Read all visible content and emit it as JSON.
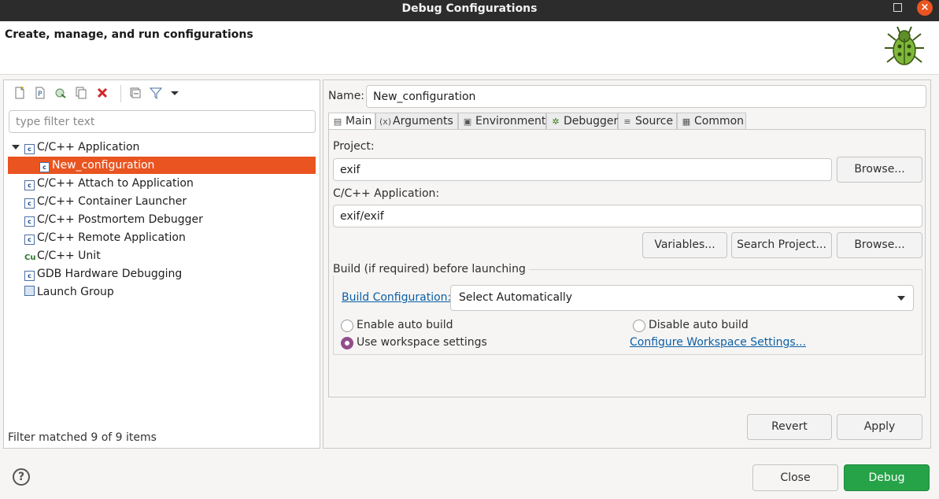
{
  "window": {
    "title": "Debug Configurations",
    "maximize_icon": "maximize-icon",
    "close_icon": "close-icon"
  },
  "header": {
    "subtitle": "Create, manage, and run configurations",
    "logo_icon": "debug-bug-icon"
  },
  "left": {
    "toolbar": [
      "new-configuration-icon",
      "new-prototype-icon",
      "export-icon",
      "duplicate-icon",
      "delete-icon",
      "collapse-all-icon",
      "filter-icon",
      "dropdown-arrow-icon"
    ],
    "filter_placeholder": "type filter text",
    "filter_value": "",
    "tree": [
      {
        "label": "C/C++ Application",
        "expanded": true
      },
      {
        "label": "New_configuration",
        "selected": true
      },
      {
        "label": "C/C++ Attach to Application"
      },
      {
        "label": "C/C++ Container Launcher"
      },
      {
        "label": "C/C++ Postmortem Debugger"
      },
      {
        "label": "C/C++ Remote Application"
      },
      {
        "label": "C/C++ Unit"
      },
      {
        "label": "GDB Hardware Debugging"
      },
      {
        "label": "Launch Group"
      }
    ],
    "status": "Filter matched 9 of 9 items"
  },
  "right": {
    "name_label": "Name:",
    "name_value": "New_configuration",
    "tabs": [
      {
        "label": "Main",
        "icon": "main-tab-icon",
        "active": true
      },
      {
        "label": "Arguments",
        "icon": "arguments-icon"
      },
      {
        "label": "Environment",
        "icon": "environment-icon"
      },
      {
        "label": "Debugger",
        "icon": "debugger-icon"
      },
      {
        "label": "Source",
        "icon": "source-icon"
      },
      {
        "label": "Common",
        "icon": "common-icon"
      }
    ],
    "main": {
      "project_label": "Project:",
      "project_value": "exif",
      "browse_label": "Browse...",
      "app_label": "C/C++ Application:",
      "app_value": "exif/exif",
      "variables_label": "Variables...",
      "search_project_label": "Search Project...",
      "browse2_label": "Browse...",
      "build_group_label": "Build (if required) before launching",
      "build_config_link": "Build Configuration:",
      "build_config_value": "Select Automatically",
      "enable_auto_build": "Enable auto build",
      "disable_auto_build": "Disable auto build",
      "use_workspace": "Use workspace settings",
      "configure_workspace_link": "Configure Workspace Settings...",
      "selected_radio": "use_workspace"
    },
    "revert_label": "Revert",
    "apply_label": "Apply"
  },
  "footer": {
    "help_icon": "help-icon",
    "help_glyph": "?",
    "close_label": "Close",
    "debug_label": "Debug",
    "colors": {
      "debug_green": "#26a348",
      "selection_orange": "#e95420"
    }
  }
}
